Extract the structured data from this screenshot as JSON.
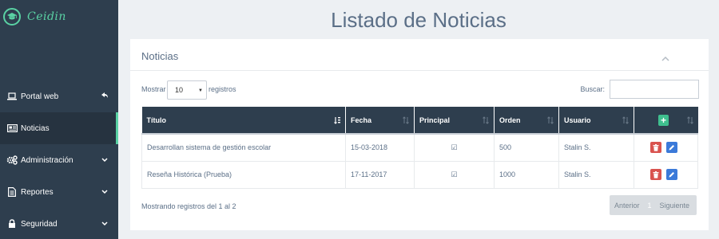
{
  "app": {
    "logo_text": "Ceidin",
    "logo_icon": "graduation-cap-icon",
    "accent_color": "#5ad2a4"
  },
  "sidebar": {
    "items": [
      {
        "label": "Portal web",
        "icon": "laptop-icon",
        "arrow": "reply-icon"
      },
      {
        "label": "Noticias",
        "icon": "newspaper-icon",
        "active": true
      },
      {
        "label": "Administración",
        "icon": "cogs-icon",
        "arrow": "chevron-down-icon"
      },
      {
        "label": "Reportes",
        "icon": "file-icon",
        "arrow": "chevron-down-icon"
      },
      {
        "label": "Seguridad",
        "icon": "lock-icon",
        "arrow": "chevron-down-icon"
      }
    ]
  },
  "page": {
    "title": "Listado de Noticias"
  },
  "panel": {
    "title": "Noticias",
    "length": {
      "label_prefix": "Mostrar",
      "value": "10",
      "label_suffix": "registros"
    },
    "search": {
      "label": "Buscar:",
      "value": ""
    },
    "table": {
      "columns": [
        "Título",
        "Fecha",
        "Principal",
        "Orden",
        "Usuario"
      ],
      "rows": [
        {
          "titulo": "Desarrollan sistema de gestión escolar",
          "fecha": "15-03-2018",
          "principal": "☑",
          "orden": "500",
          "usuario": "Stalin S."
        },
        {
          "titulo": "Reseña Histórica (Prueba)",
          "fecha": "17-11-2017",
          "principal": "☑",
          "orden": "1000",
          "usuario": "Stalin S."
        }
      ],
      "add_label": "+"
    },
    "info": "Mostrando registros del 1 al 2",
    "pager": {
      "prev": "Anterior",
      "current": "1",
      "next": "Siguiente"
    }
  }
}
